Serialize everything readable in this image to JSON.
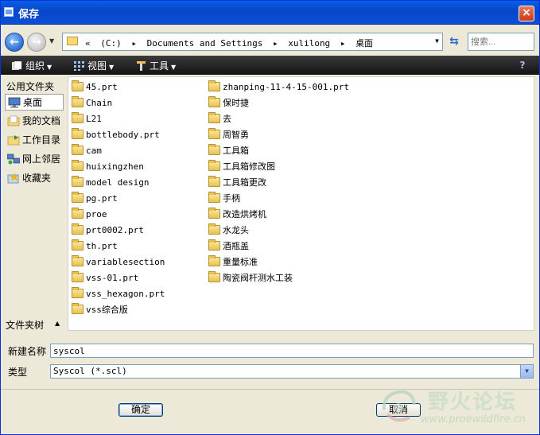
{
  "window": {
    "title": "保存",
    "close_glyph": "×"
  },
  "address": {
    "back_glyph": "←",
    "forward_glyph": "→",
    "crumbs": [
      "«",
      "(C:)",
      "▸",
      "Documents and Settings",
      "▸",
      "xulilong",
      "▸",
      "桌面"
    ],
    "refresh_glyph": "⇆",
    "search_placeholder": "搜索..."
  },
  "toolbar": {
    "organize": "组织",
    "view": "视图",
    "tools": "工具",
    "help_glyph": "?"
  },
  "sidebar": {
    "header": "公用文件夹",
    "items": [
      {
        "label": "桌面",
        "icon": "desktop-icon",
        "selected": true
      },
      {
        "label": "我的文档",
        "icon": "my-documents-icon",
        "selected": false
      },
      {
        "label": "工作目录",
        "icon": "working-directory-icon",
        "selected": false
      },
      {
        "label": "网上邻居",
        "icon": "network-places-icon",
        "selected": false
      },
      {
        "label": "收藏夹",
        "icon": "favorites-icon",
        "selected": false
      }
    ],
    "footer": "文件夹树"
  },
  "files": {
    "col1": [
      "45.prt",
      "Chain",
      "L21",
      "bottlebody.prt",
      "cam",
      "huixingzhen",
      "model design",
      "pg.prt",
      "proe",
      "prt0002.prt",
      "th.prt",
      "variablesection",
      "vss-01.prt",
      "vss_hexagon.prt",
      "vss综合版"
    ],
    "col2": [
      "zhanping-11-4-15-001.prt",
      "保时捷",
      "去",
      "周智勇",
      "工具箱",
      "工具箱修改图",
      "工具箱更改",
      "手柄",
      "改造烘烤机",
      "水龙头",
      "酒瓶盖",
      "重量标准",
      "陶瓷阀杆测水工装"
    ]
  },
  "form": {
    "name_label": "新建名称",
    "name_value": "syscol",
    "type_label": "类型",
    "type_value": "Syscol (*.scl)"
  },
  "buttons": {
    "ok": "确定",
    "cancel": "取消"
  },
  "watermark": {
    "text": "野火论坛",
    "url": "www.proewildfire.cn"
  },
  "colors": {
    "titlebar": "#0a5ee8",
    "toolbar": "#1e1e1e",
    "dialog_bg": "#ece9d8"
  }
}
